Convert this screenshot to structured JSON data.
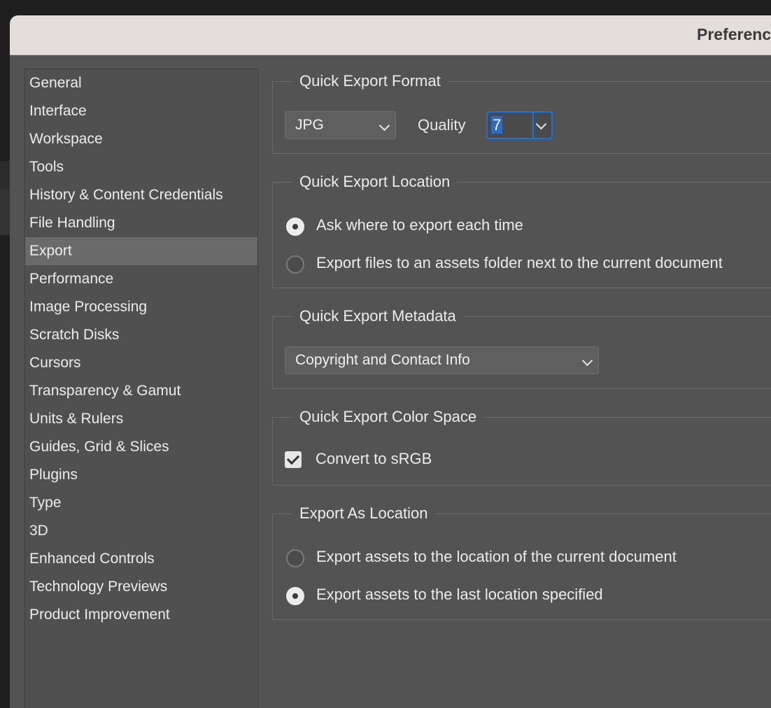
{
  "window": {
    "title": "Preferences"
  },
  "sidebar": {
    "items": [
      {
        "label": "General"
      },
      {
        "label": "Interface"
      },
      {
        "label": "Workspace"
      },
      {
        "label": "Tools"
      },
      {
        "label": "History & Content Credentials"
      },
      {
        "label": "File Handling"
      },
      {
        "label": "Export",
        "selected": true
      },
      {
        "label": "Performance"
      },
      {
        "label": "Image Processing"
      },
      {
        "label": "Scratch Disks"
      },
      {
        "label": "Cursors"
      },
      {
        "label": "Transparency & Gamut"
      },
      {
        "label": "Units & Rulers"
      },
      {
        "label": "Guides, Grid & Slices"
      },
      {
        "label": "Plugins"
      },
      {
        "label": "Type"
      },
      {
        "label": "3D"
      },
      {
        "label": "Enhanced Controls"
      },
      {
        "label": "Technology Previews"
      },
      {
        "label": "Product Improvement"
      }
    ]
  },
  "quick_export_format": {
    "title": "Quick Export Format",
    "format_value": "JPG",
    "quality_label": "Quality",
    "quality_value": "7"
  },
  "quick_export_location": {
    "title": "Quick Export Location",
    "options": [
      {
        "label": "Ask where to export each time",
        "selected": true
      },
      {
        "label": "Export files to an assets folder next to the current document",
        "selected": false
      }
    ]
  },
  "quick_export_metadata": {
    "title": "Quick Export Metadata",
    "value": "Copyright and Contact Info"
  },
  "quick_export_color_space": {
    "title": "Quick Export Color Space",
    "checkbox_label": "Convert to sRGB",
    "checked": true
  },
  "export_as_location": {
    "title": "Export As Location",
    "options": [
      {
        "label": "Export assets to the location of the current document",
        "selected": false
      },
      {
        "label": "Export assets to the last location specified",
        "selected": true
      }
    ]
  },
  "colors": {
    "accent": "#1473e6",
    "panel": "#535353",
    "titlebar": "#e3deda",
    "selected_item": "#6a6a6a"
  }
}
